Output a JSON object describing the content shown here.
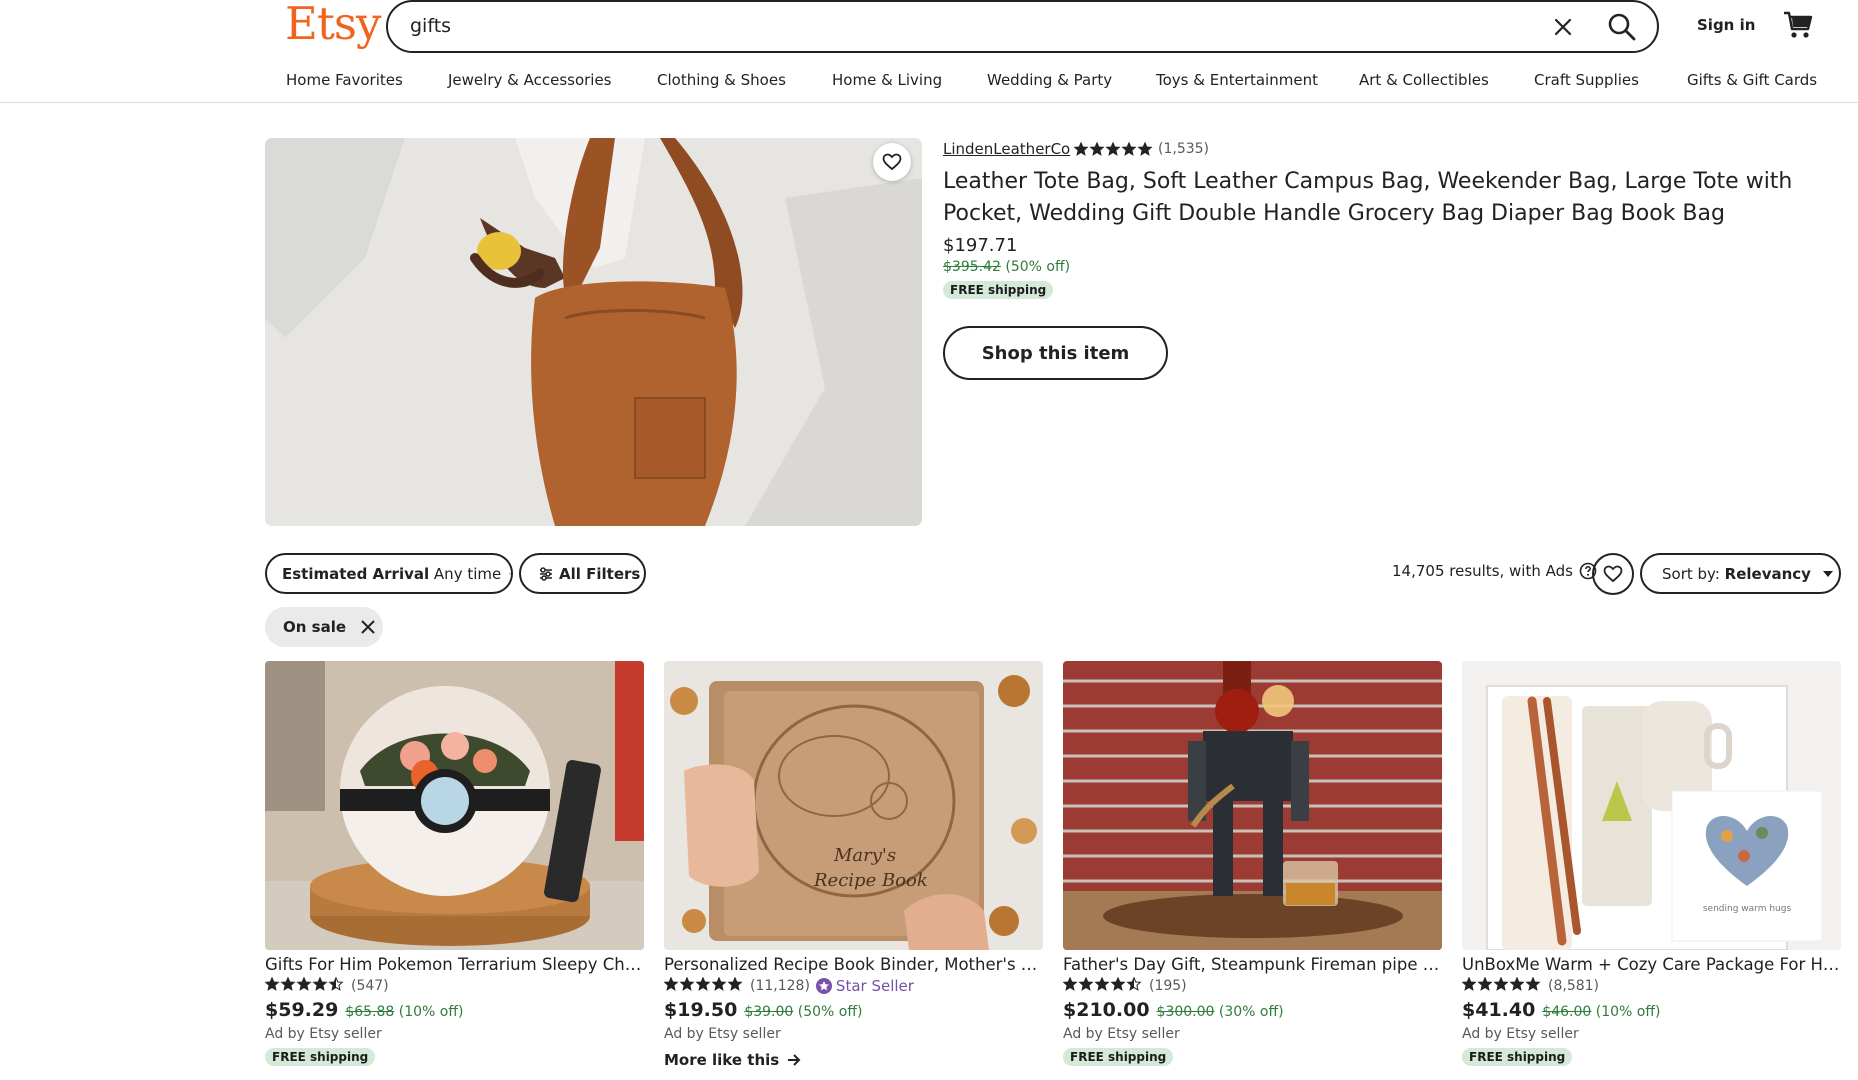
{
  "header": {
    "logo": "Etsy",
    "search_value": "gifts",
    "sign_in": "Sign in"
  },
  "nav": [
    "Home Favorites",
    "Jewelry & Accessories",
    "Clothing & Shoes",
    "Home & Living",
    "Wedding & Party",
    "Toys & Entertainment",
    "Art & Collectibles",
    "Craft Supplies",
    "Gifts & Gift Cards"
  ],
  "featured": {
    "shop_name": "LindenLeatherCo",
    "rating": 5,
    "reviews": "(1,535)",
    "title": "Leather Tote Bag, Soft Leather Campus Bag, Weekender Bag, Large Tote with Pocket, Wedding Gift Double Handle Grocery Bag Diaper Bag Book Bag",
    "price": "$197.71",
    "original_price": "$395.42",
    "discount": "(50% off)",
    "shipping": "FREE shipping",
    "cta": "Shop this item"
  },
  "filters": {
    "arrival_label": "Estimated Arrival",
    "arrival_value": "Any time",
    "all_filters": "All Filters",
    "results": "14,705 results, with Ads",
    "sort_label": "Sort by:",
    "sort_value": "Relevancy",
    "active_chip": "On sale"
  },
  "listings": [
    {
      "title": "Gifts For Him Pokemon Terrarium Sleepy Charmander Night Light",
      "rating": 4.5,
      "reviews": "(547)",
      "price": "$59.29",
      "original_price": "$65.88",
      "discount": "(10% off)",
      "ad": "Ad by Etsy seller",
      "shipping": "FREE shipping"
    },
    {
      "title": "Personalized Recipe Book Binder, Mother's Day Gift",
      "rating": 5,
      "reviews": "(11,128)",
      "star_seller": "Star Seller",
      "price": "$19.50",
      "original_price": "$39.00",
      "discount": "(50% off)",
      "ad": "Ad by Etsy seller",
      "more": "More like this"
    },
    {
      "title": "Father's Day Gift, Steampunk Fireman pipe Robot Liquor Dispenser",
      "rating": 4.5,
      "reviews": "(195)",
      "price": "$210.00",
      "original_price": "$300.00",
      "discount": "(30% off)",
      "ad": "Ad by Etsy seller",
      "shipping": "FREE shipping"
    },
    {
      "title": "UnBoxMe Warm + Cozy Care Package For Her, Self Care Gift Box",
      "rating": 5,
      "reviews": "(8,581)",
      "price": "$41.40",
      "original_price": "$46.00",
      "discount": "(10% off)",
      "ad": "Ad by Etsy seller",
      "shipping": "FREE shipping"
    }
  ],
  "card_texts": {
    "heart_card": "sending warm hugs",
    "recipe_name": "Mary's",
    "recipe_book": "Recipe Book"
  },
  "colors": {
    "brand": "#F1641E",
    "sale_green": "#2f7d3a",
    "badge_bg": "#d4e9d7",
    "star_seller": "#7851a9"
  }
}
